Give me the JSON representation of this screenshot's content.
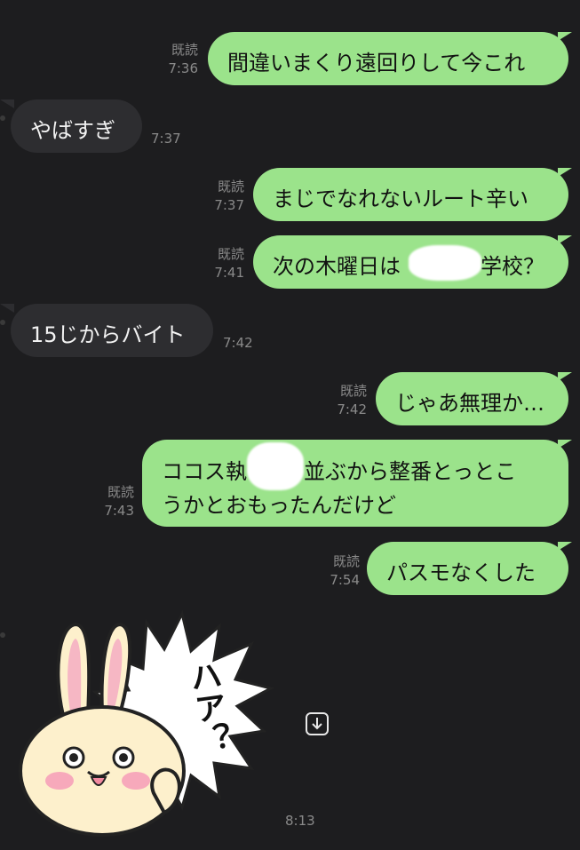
{
  "messages": [
    {
      "side": "out",
      "text": "間違いまくり遠回りして今これ",
      "read": "既読",
      "time": "7:36"
    },
    {
      "side": "in",
      "text": "やばすぎ",
      "time": "7:37"
    },
    {
      "side": "out",
      "text": "まじでなれないルート辛い",
      "read": "既読",
      "time": "7:37"
    },
    {
      "side": "out",
      "text_before": "次の木曜日は",
      "text_after": "学校？",
      "read": "既読",
      "time": "7:41"
    },
    {
      "side": "in",
      "text": "15じからバイト",
      "time": "7:42"
    },
    {
      "side": "out",
      "text": "じゃあ無理か…",
      "read": "既読",
      "time": "7:42"
    },
    {
      "side": "out",
      "line1_before": "ココス執",
      "line1_after": "並ぶから整番とっとこ",
      "line2": "うかとおもったんだけど",
      "read": "既読",
      "time": "7:43"
    },
    {
      "side": "out",
      "text": "パスモなくした",
      "read": "既読",
      "time": "7:54"
    }
  ],
  "sticker": {
    "text": "ハア？",
    "time": "8:13",
    "icon": "rabbit-sticker"
  },
  "scroll_button": {
    "icon": "arrow-down-icon"
  },
  "colors": {
    "background": "#1d1d1f",
    "outgoing": "#9be38b",
    "incoming": "#2d2d30",
    "meta": "#8a8a8a"
  }
}
